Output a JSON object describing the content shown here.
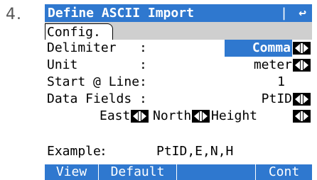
{
  "step_number": "4.",
  "title": "Define ASCII Import",
  "title_separator": "|",
  "back_icon": "↩",
  "tab": "Config.",
  "rows": {
    "delimiter": {
      "label": "Delimiter",
      "colon": ":",
      "value": "Comma"
    },
    "unit": {
      "label": "Unit",
      "colon": ":",
      "value": "meter"
    },
    "start_line": {
      "label": "Start @ Line",
      "colon": ":",
      "value": "1"
    },
    "data_fields": {
      "label": "Data Fields",
      "colon": ":",
      "value": "PtID"
    }
  },
  "fields": {
    "east": "East",
    "north": "North",
    "height": "Height"
  },
  "example": {
    "label": "Example",
    "colon": ":",
    "value": "PtID,E,N,H"
  },
  "softkeys": {
    "view": "View",
    "default": "Default",
    "cont": "Cont"
  },
  "colors": {
    "accent": "#2f78cf",
    "tab_strip": "#cfcfcf"
  }
}
